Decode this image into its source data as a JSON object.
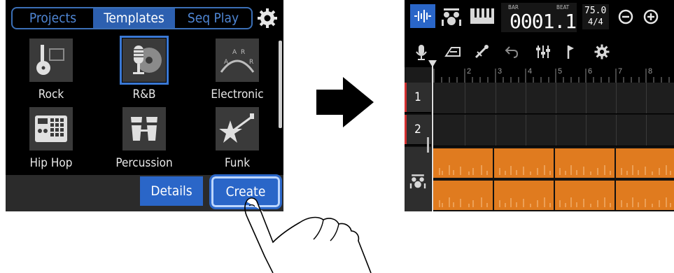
{
  "template_screen": {
    "tabs": [
      {
        "label": "Projects",
        "active": false
      },
      {
        "label": "Templates",
        "active": true
      },
      {
        "label": "Seq Play",
        "active": false
      }
    ],
    "tiles": [
      {
        "label": "Rock",
        "icon": "guitar-icon",
        "selected": false
      },
      {
        "label": "R&B",
        "icon": "microphone-record-icon",
        "selected": true
      },
      {
        "label": "Electronic",
        "icon": "synth-wave-icon",
        "selected": false
      },
      {
        "label": "Hip Hop",
        "icon": "drum-machine-icon",
        "selected": false
      },
      {
        "label": "Percussion",
        "icon": "bongo-icon",
        "selected": false
      },
      {
        "label": "Funk",
        "icon": "bass-star-icon",
        "selected": false
      }
    ],
    "details_label": "Details",
    "create_label": "Create"
  },
  "project_screen": {
    "counter": {
      "bar_label": "BAR",
      "beat_label": "BEAT",
      "value": "0001.1"
    },
    "tempo": "75.0",
    "meter": "4/4",
    "ruler_numbers": [
      "2",
      "3",
      "4",
      "5",
      "6",
      "7",
      "8"
    ],
    "tracks": [
      {
        "label": "1"
      },
      {
        "label": "2"
      }
    ]
  },
  "colors": {
    "accent_blue": "#2a66c8",
    "clip_orange": "#e07b1f",
    "track_red": "#d23030"
  }
}
